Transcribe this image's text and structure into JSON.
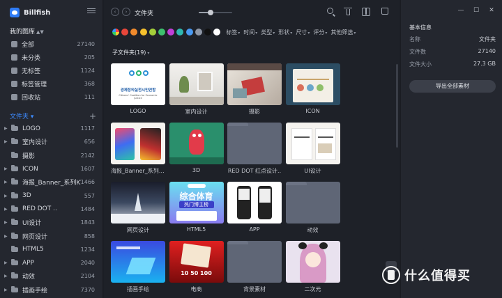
{
  "app": {
    "name": "Billfish"
  },
  "library": {
    "title": "我的图库",
    "items": [
      {
        "label": "全部",
        "count": "27140",
        "icon": "grid-icon"
      },
      {
        "label": "未分类",
        "count": "205",
        "icon": "uncategorized-icon"
      },
      {
        "label": "无标签",
        "count": "1124",
        "icon": "no-tag-icon"
      },
      {
        "label": "标签管理",
        "count": "368",
        "icon": "tag-manage-icon"
      },
      {
        "label": "回收站",
        "count": "111",
        "icon": "trash-icon"
      }
    ]
  },
  "folders": {
    "title": "文件夹",
    "items": [
      {
        "label": "LOGO",
        "count": "1117",
        "expandable": true
      },
      {
        "label": "室内设计",
        "count": "656",
        "expandable": true
      },
      {
        "label": "摄影",
        "count": "2142",
        "expandable": false
      },
      {
        "label": "ICON",
        "count": "1607",
        "expandable": true
      },
      {
        "label": "海报_Banner_系列KV",
        "count": "1466",
        "expandable": true
      },
      {
        "label": "3D",
        "count": "557",
        "expandable": true
      },
      {
        "label": "RED DOT ..",
        "count": "1484",
        "expandable": true
      },
      {
        "label": "UI设计",
        "count": "1843",
        "expandable": true
      },
      {
        "label": "网页设计",
        "count": "858",
        "expandable": true
      },
      {
        "label": "HTML5",
        "count": "1234",
        "expandable": false
      },
      {
        "label": "APP",
        "count": "2040",
        "expandable": true
      },
      {
        "label": "动效",
        "count": "2104",
        "expandable": true
      },
      {
        "label": "插画手绘",
        "count": "7370",
        "expandable": true
      }
    ]
  },
  "topbar": {
    "breadcrumb": "文件夹",
    "zoom": 0.35
  },
  "filters": {
    "colors": [
      "#e8463a",
      "#f08a2c",
      "#f5c02d",
      "#a4cf3a",
      "#3ec06e",
      "#c040d8",
      "#2fb8b0",
      "#4a9af2",
      "#8f97a6",
      "#111111",
      "#ffffff"
    ],
    "options": [
      "标签",
      "时间",
      "类型",
      "形状",
      "尺寸",
      "评分",
      "其他筛选"
    ]
  },
  "subfolder": {
    "title": "子文件夹",
    "count": "(19)"
  },
  "cards": [
    {
      "name": "LOGO",
      "style": "logo"
    },
    {
      "name": "室内设计",
      "style": "interior"
    },
    {
      "name": "摄影",
      "style": "photo"
    },
    {
      "name": "ICON",
      "style": "icon"
    },
    {
      "name": "海报_Banner_系列KV",
      "style": "poster"
    },
    {
      "name": "3D",
      "style": "three-d"
    },
    {
      "name": "RED DOT 红点设计..",
      "style": "empty"
    },
    {
      "name": "UI设计",
      "style": "ui"
    },
    {
      "name": "网页设计",
      "style": "web"
    },
    {
      "name": "HTML5",
      "style": "h5"
    },
    {
      "name": "APP",
      "style": "app"
    },
    {
      "name": "动效",
      "style": "empty"
    },
    {
      "name": "插画手绘",
      "style": "illustration"
    },
    {
      "name": "电商",
      "style": "ecommerce"
    },
    {
      "name": "背景素材",
      "style": "empty"
    },
    {
      "name": "二次元",
      "style": "anime"
    }
  ],
  "thumb_text": {
    "logo": "경제정의실천시민연합",
    "logo_sub": "Citizens' Coalition for Economic Justice",
    "h5_title": "综合体育",
    "h5_sub": "热门博主榜",
    "ec_time": "10 50 100"
  },
  "info": {
    "title": "基本信息",
    "rows": [
      {
        "key": "名称",
        "value": "文件夹"
      },
      {
        "key": "文件数",
        "value": "27140"
      },
      {
        "key": "文件大小",
        "value": "27.3 GB"
      }
    ],
    "export_label": "导出全部素材"
  },
  "watermark": {
    "text": "什么值得买"
  }
}
